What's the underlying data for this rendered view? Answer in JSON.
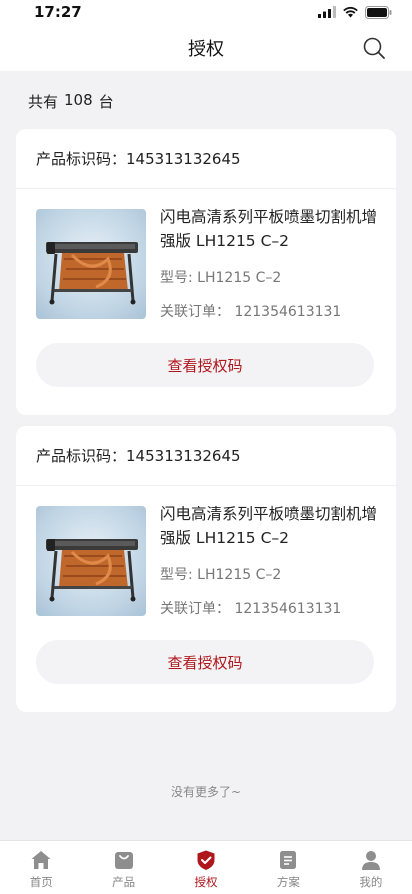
{
  "status": {
    "time": "17:27"
  },
  "header": {
    "title": "授权"
  },
  "summary": {
    "prefix": "共有",
    "count": "108",
    "suffix": "台"
  },
  "cards": [
    {
      "id_label": "产品标识码：",
      "id_value": "145313132645",
      "product_name": "闪电高清系列平板喷墨切割机增强版 LH1215 C–2",
      "model_label": "型号:",
      "model_value": "LH1215  C–2",
      "order_label": "关联订单：",
      "order_value": "121354613131",
      "button_label": "查看授权码"
    },
    {
      "id_label": "产品标识码：",
      "id_value": "145313132645",
      "product_name": "闪电高清系列平板喷墨切割机增强版 LH1215 C–2",
      "model_label": "型号:",
      "model_value": "LH1215  C–2",
      "order_label": "关联订单：",
      "order_value": "121354613131",
      "button_label": "查看授权码"
    }
  ],
  "footer_note": "没有更多了~",
  "tabs": [
    {
      "label": "首页",
      "icon": "home-icon"
    },
    {
      "label": "产品",
      "icon": "product-bag-icon"
    },
    {
      "label": "授权",
      "icon": "authorization-shield-icon",
      "active": true
    },
    {
      "label": "方案",
      "icon": "document-icon"
    },
    {
      "label": "我的",
      "icon": "user-icon"
    }
  ],
  "colors": {
    "accent": "#b0171d",
    "tab_inactive": "#8e8e8e",
    "background": "#f2f2f4"
  }
}
